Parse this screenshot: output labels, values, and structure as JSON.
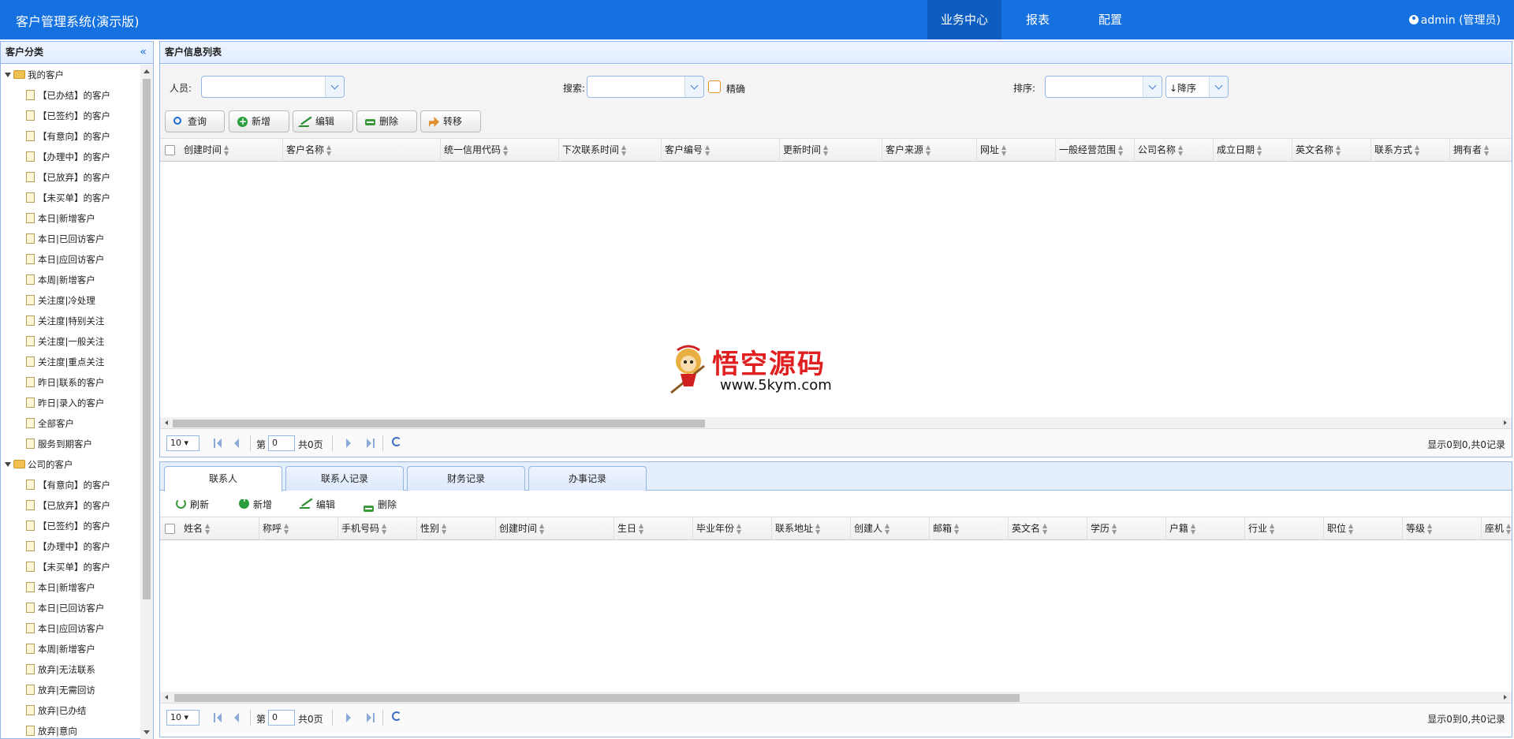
{
  "app": {
    "title": "客户管理系统(演示版)",
    "user": "admin (管理员)"
  },
  "nav": [
    "业务中心",
    "报表",
    "配置"
  ],
  "sidebar": {
    "title": "客户分类",
    "groups": [
      {
        "label": "我的客户",
        "items": [
          "【已办结】的客户",
          "【已签约】的客户",
          "【有意向】的客户",
          "【办理中】的客户",
          "【已放弃】的客户",
          "【未买单】的客户",
          "本日|新增客户",
          "本日|已回访客户",
          "本日|应回访客户",
          "本周|新增客户",
          "关注度|冷处理",
          "关注度|特别关注",
          "关注度|一般关注",
          "关注度|重点关注",
          "昨日|联系的客户",
          "昨日|录入的客户",
          "全部客户",
          "服务到期客户"
        ]
      },
      {
        "label": "公司的客户",
        "items": [
          "【有意向】的客户",
          "【已放弃】的客户",
          "【已签约】的客户",
          "【办理中】的客户",
          "【未买单】的客户",
          "本日|新增客户",
          "本日|已回访客户",
          "本日|应回访客户",
          "本周|新增客户",
          "放弃|无法联系",
          "放弃|无需回访",
          "放弃|已办结",
          "放弃|意向"
        ]
      }
    ]
  },
  "main": {
    "title": "客户信息列表",
    "filters": {
      "staff_label": "人员:",
      "search_label": "搜索:",
      "exact_label": "精确",
      "sort_label": "排序:",
      "sort_order": "↓降序"
    },
    "buttons": {
      "query": "查询",
      "add": "新增",
      "edit": "编辑",
      "delete": "删除",
      "transfer": "转移"
    },
    "columns": [
      "创建时间",
      "客户名称",
      "统一信用代码",
      "下次联系时间",
      "客户编号",
      "更新时间",
      "客户来源",
      "网址",
      "一般经营范围",
      "公司名称",
      "成立日期",
      "英文名称",
      "联系方式",
      "拥有者"
    ],
    "pager": {
      "page_size": "10",
      "page_label": "第",
      "page": "0",
      "total_label": "共0页",
      "info": "显示0到0,共0记录"
    }
  },
  "bottom": {
    "tabs": [
      "联系人",
      "联系人记录",
      "财务记录",
      "办事记录"
    ],
    "buttons": {
      "refresh": "刷新",
      "add": "新增",
      "edit": "编辑",
      "delete": "删除"
    },
    "columns": [
      "姓名",
      "称呼",
      "手机号码",
      "性别",
      "创建时间",
      "生日",
      "毕业年份",
      "联系地址",
      "创建人",
      "邮箱",
      "英文名",
      "学历",
      "户籍",
      "行业",
      "职位",
      "等级",
      "座机"
    ],
    "pager": {
      "page_size": "10",
      "page_label": "第",
      "page": "0",
      "total_label": "共0页",
      "info": "显示0到0,共0记录"
    }
  },
  "watermark": {
    "cn": "悟空源码",
    "en": "www.5kym.com"
  }
}
